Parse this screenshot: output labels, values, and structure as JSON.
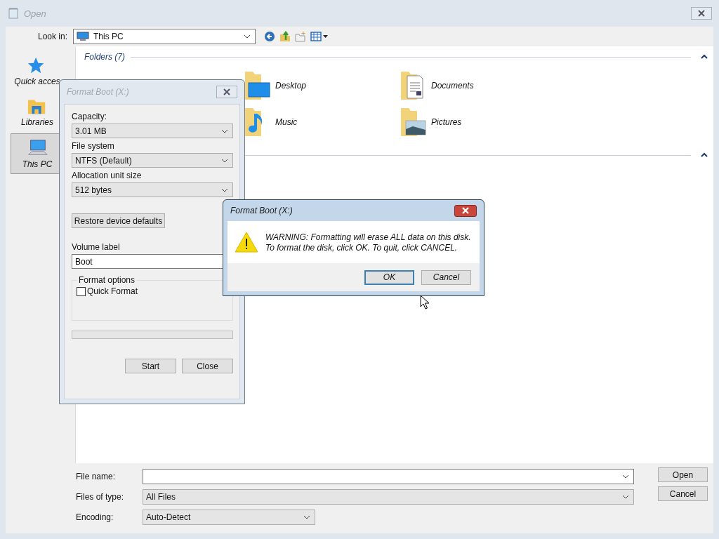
{
  "window": {
    "title": "Open"
  },
  "look_in": {
    "label": "Look in:",
    "value": "This PC"
  },
  "sidebar": {
    "items": [
      {
        "label": "Quick acces",
        "kind": "star",
        "selected": false
      },
      {
        "label": "Libraries",
        "kind": "library",
        "selected": false
      },
      {
        "label": "This PC",
        "kind": "computer",
        "selected": true
      }
    ]
  },
  "sections": [
    {
      "title": "Folders (7)",
      "expanded": true,
      "items": [
        {
          "name": "Desktop",
          "kind": "desktop"
        },
        {
          "name": "Documents",
          "kind": "documents"
        },
        {
          "name": "Music",
          "kind": "music"
        },
        {
          "name": "Pictures",
          "kind": "pictures"
        }
      ]
    },
    {
      "expanded": true
    }
  ],
  "bottom": {
    "fields": [
      {
        "label": "File name:",
        "kind": "combo-edit"
      },
      {
        "label": "Files of type:",
        "value": "All Files",
        "kind": "combo"
      },
      {
        "label": "Encoding:",
        "value": "Auto-Detect",
        "kind": "combo-short"
      }
    ],
    "buttons": [
      "Open",
      "Cancel"
    ]
  },
  "format_dialog": {
    "title": "Format Boot (X:)",
    "active": false,
    "selects": [
      {
        "label": "Capacity:",
        "value": "3.01 MB"
      },
      {
        "label": "File system",
        "value": "NTFS (Default)"
      },
      {
        "label": "Allocation unit size",
        "value": "512 bytes"
      }
    ],
    "restore_button": "Restore device defaults",
    "volume_label": {
      "label": "Volume label",
      "value": "Boot"
    },
    "format_options": {
      "title": "Format options",
      "quick_format": {
        "label": "Quick Format",
        "checked": false
      }
    },
    "progress": {
      "level": 0
    },
    "buttons": [
      "Start",
      "Close"
    ]
  },
  "warning_dialog": {
    "title": "Format Boot (X:)",
    "active": true,
    "message": [
      "WARNING: Formatting will erase ALL data on this disk.",
      "To format the disk, click OK. To quit, click CANCEL."
    ],
    "buttons": [
      {
        "label": "OK",
        "selected": true
      },
      {
        "label": "Cancel",
        "selected": false
      }
    ]
  }
}
